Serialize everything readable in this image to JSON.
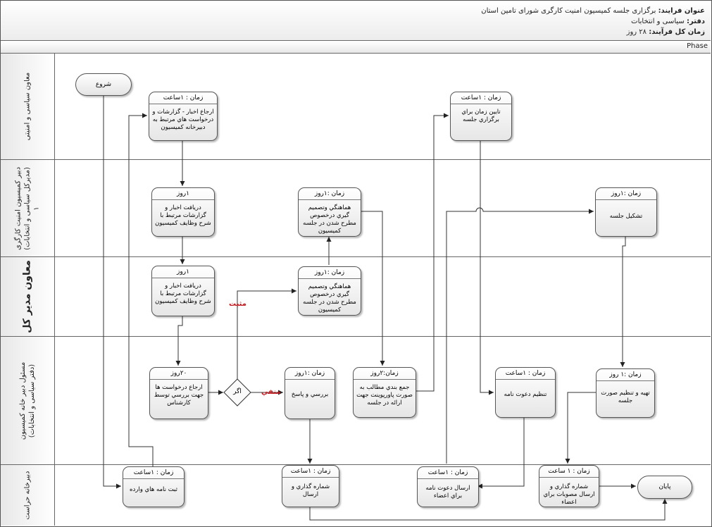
{
  "header": {
    "title_label": "عنوان فرایند:",
    "title_value": "برگزاری جلسه کمیسیون امنیت کارگری شورای تامین استان",
    "office_label": "دفتر:",
    "office_value": "سیاسی و انتخابات",
    "time_label": "زمان کل فرآیند:",
    "time_value": "۲۸ روز"
  },
  "phase": "Phase",
  "lanes": [
    {
      "label": "معاون سیاسی و امنیتی"
    },
    {
      "label": "دبیر کمیسیون امنیت کارگری\n(مدیرکل سیاسی و انتخابات)\n۱"
    },
    {
      "label": "معاون مدیر کل"
    },
    {
      "label": "مسئول دبیر خانه کمیسیون\n(دفتر سیاسی و انتخابات)"
    },
    {
      "label": "دبیرخانه حراست"
    }
  ],
  "terminals": {
    "start": "شروع",
    "end": "پایان"
  },
  "tasks": {
    "t1": {
      "time": "زمان : ۱ساعت",
      "text": "ارجاع اخبار - گزارشات و درخواست هاي مرتبط به دبيرخانه كميسيون"
    },
    "t2": {
      "time": "زمان : ۱ساعت",
      "text": "تايين زمان براي برگزاري جلسه"
    },
    "t3": {
      "time": "۱روز",
      "text": "دريافت اخبار و گزارشات مرتبط با شرح وظايف كميسيون"
    },
    "t4": {
      "time": "زمان :۱روز",
      "text": "هماهنگي وتصميم گيري درخصوص مطرح شدن در جلسه كميسيون"
    },
    "t5": {
      "time": "زمان :۱روز",
      "text": "تشكيل جلسه"
    },
    "t6": {
      "time": "۱روز",
      "text": "دريافت اخبار و گزارشات مرتبط با شرح وظايف كميسيون"
    },
    "t7": {
      "time": "زمان :۱روز",
      "text": "هماهنگي وتصميم گيري درخصوص مطرح شدن در جلسه كميسيون"
    },
    "t8": {
      "time": "۲۰روز",
      "text": "ارجاع درخواست ها جهت بررسي توسط كارشناس"
    },
    "t9": {
      "time": "زمان :۱روز",
      "text": "بررسي و پاسخ"
    },
    "t10": {
      "time": "زمان:۲روز",
      "text": "جمع بندي مطالب به صورت پاورپوينت جهت ارائه در جلسه"
    },
    "t11": {
      "time": "زمان : ۱ساعت",
      "text": "تنظيم دعوت نامه"
    },
    "t12": {
      "time": "زمان :۱ روز",
      "text": "تهيه و تنظيم صورت جلسه"
    },
    "t13": {
      "time": "زمان : ۱ساعت",
      "text": "ثبت نامه هاي وارده"
    },
    "t14": {
      "time": "زمان : ۱ساعت",
      "text": "شماره گذاري و ارسال"
    },
    "t15": {
      "time": "زمان : ۱ساعت",
      "text": "ارسال دعوت نامه براي اعضاء"
    },
    "t16": {
      "time": "زمان : ۱ ساعت",
      "text": "شماره گذاري و ارسال مصوبات براي اعضاء"
    }
  },
  "decision": {
    "text": "اگر",
    "yes": "مثبت",
    "no": "منفي"
  }
}
